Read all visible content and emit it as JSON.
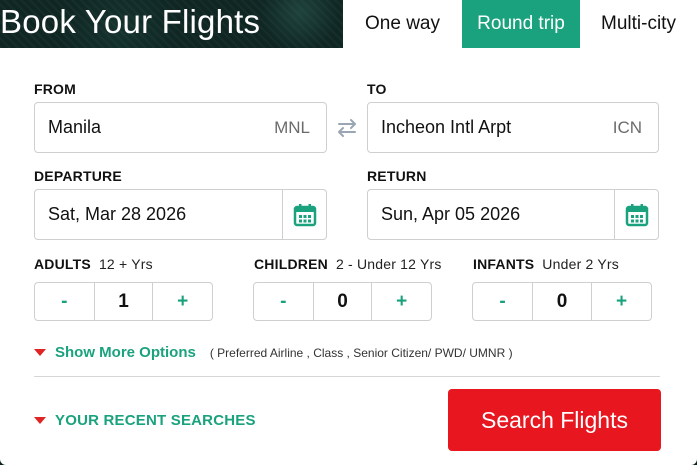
{
  "header": {
    "title": "Book Your Flights"
  },
  "tabs": [
    {
      "label": "One way",
      "active": false
    },
    {
      "label": "Round trip",
      "active": true
    },
    {
      "label": "Multi-city",
      "active": false
    }
  ],
  "from": {
    "label": "FROM",
    "city": "Manila",
    "code": "MNL"
  },
  "to": {
    "label": "TO",
    "city": "Incheon Intl Arpt",
    "code": "ICN"
  },
  "departure": {
    "label": "DEPARTURE",
    "value": "Sat, Mar 28 2026"
  },
  "return": {
    "label": "RETURN",
    "value": "Sun, Apr 05 2026"
  },
  "passengers": {
    "adults": {
      "label": "ADULTS",
      "sub": "12 + Yrs",
      "value": "1"
    },
    "children": {
      "label": "CHILDREN",
      "sub": "2 - Under 12 Yrs",
      "value": "0"
    },
    "infants": {
      "label": "INFANTS",
      "sub": "Under 2 Yrs",
      "value": "0"
    },
    "minus": "-",
    "plus": "+"
  },
  "options": {
    "label": "Show More Options",
    "hint": "( Preferred Airline , Class , Senior Citizen/ PWD/ UMNR )"
  },
  "recent": {
    "label": "YOUR RECENT SEARCHES"
  },
  "search_button": "Search Flights",
  "colors": {
    "accent": "#1aa27e",
    "cta": "#e7161f",
    "caret": "#e02424"
  }
}
